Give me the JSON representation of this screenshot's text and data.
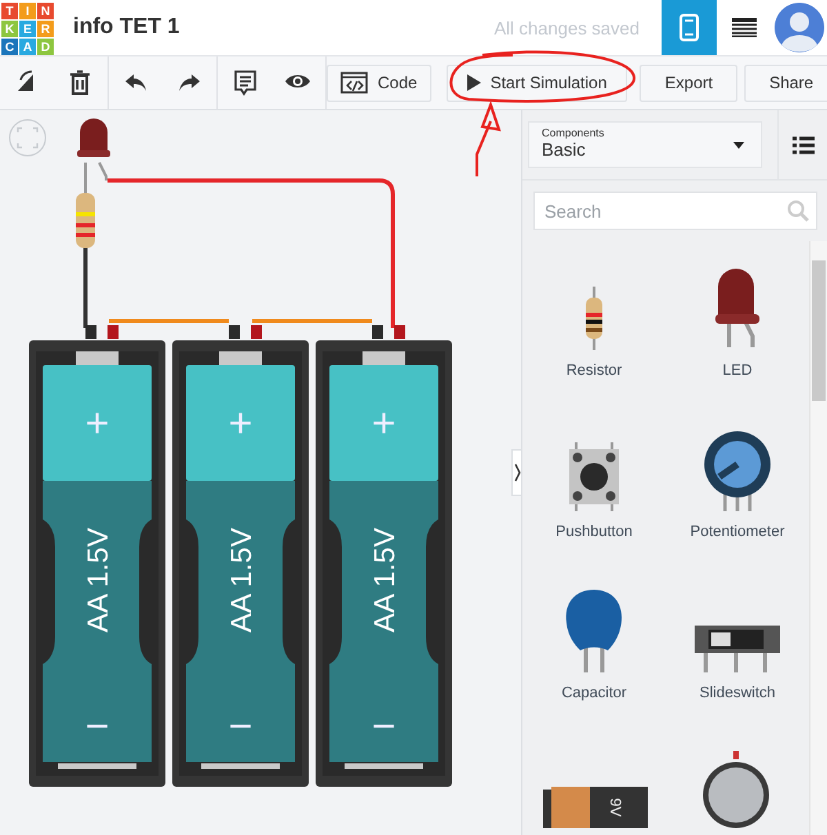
{
  "header": {
    "logo_letters": [
      "T",
      "I",
      "N",
      "K",
      "E",
      "R",
      "C",
      "A",
      "D"
    ],
    "title": "info TET 1",
    "save_status": "All changes saved",
    "view_tabs": [
      {
        "kind": "circuit",
        "selected": true
      },
      {
        "kind": "table",
        "selected": false
      }
    ]
  },
  "toolbar": {
    "buttons": [
      {
        "kind": "code",
        "label": "Code"
      },
      {
        "kind": "play",
        "label": "Start Simulation"
      },
      {
        "kind": "plain",
        "label": "Export"
      },
      {
        "kind": "plain",
        "label": "Share"
      }
    ]
  },
  "canvas": {
    "batteries": [
      {
        "label": "AA 1.5V",
        "plus": "+",
        "minus": "−"
      },
      {
        "label": "AA 1.5V",
        "plus": "+",
        "minus": "−"
      },
      {
        "label": "AA 1.5V",
        "plus": "+",
        "minus": "−"
      }
    ]
  },
  "panel": {
    "dropdown": {
      "label": "Components",
      "value": "Basic"
    },
    "search": {
      "placeholder": "Search"
    },
    "components": [
      {
        "kind": "resistor",
        "name": "Resistor"
      },
      {
        "kind": "led",
        "name": "LED"
      },
      {
        "kind": "pushbutton",
        "name": "Pushbutton"
      },
      {
        "kind": "potentiometer",
        "name": "Potentiometer"
      },
      {
        "kind": "capacitor",
        "name": "Capacitor"
      },
      {
        "kind": "slideswitch",
        "name": "Slideswitch"
      },
      {
        "kind": "battery9v",
        "marking": "9V"
      },
      {
        "kind": "coin"
      }
    ]
  }
}
